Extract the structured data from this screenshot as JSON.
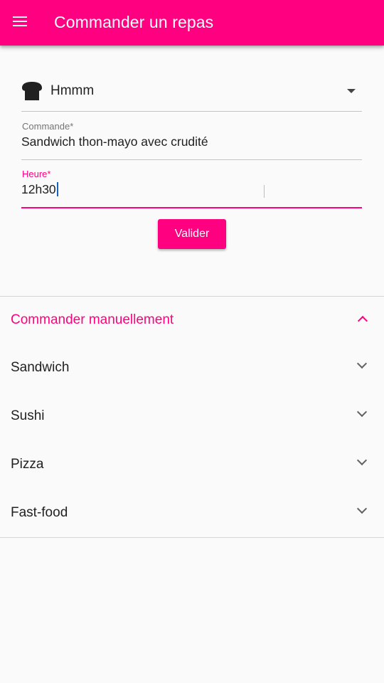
{
  "appbar": {
    "title": "Commander un repas",
    "menu_icon": "hamburger-menu-icon",
    "color": "#ff0080"
  },
  "form": {
    "restaurant_select": {
      "icon": "bread-toast-icon",
      "value": "Hmmm"
    },
    "commande": {
      "label": "Commande*",
      "value": "Sandwich thon-mayo avec crudité"
    },
    "heure": {
      "label": "Heure*",
      "value": "12h30"
    },
    "submit_label": "Valider"
  },
  "manual": {
    "title": "Commander manuellement",
    "expanded": true,
    "categories": [
      {
        "label": "Sandwich"
      },
      {
        "label": "Sushi"
      },
      {
        "label": "Pizza"
      },
      {
        "label": "Fast-food"
      }
    ]
  }
}
